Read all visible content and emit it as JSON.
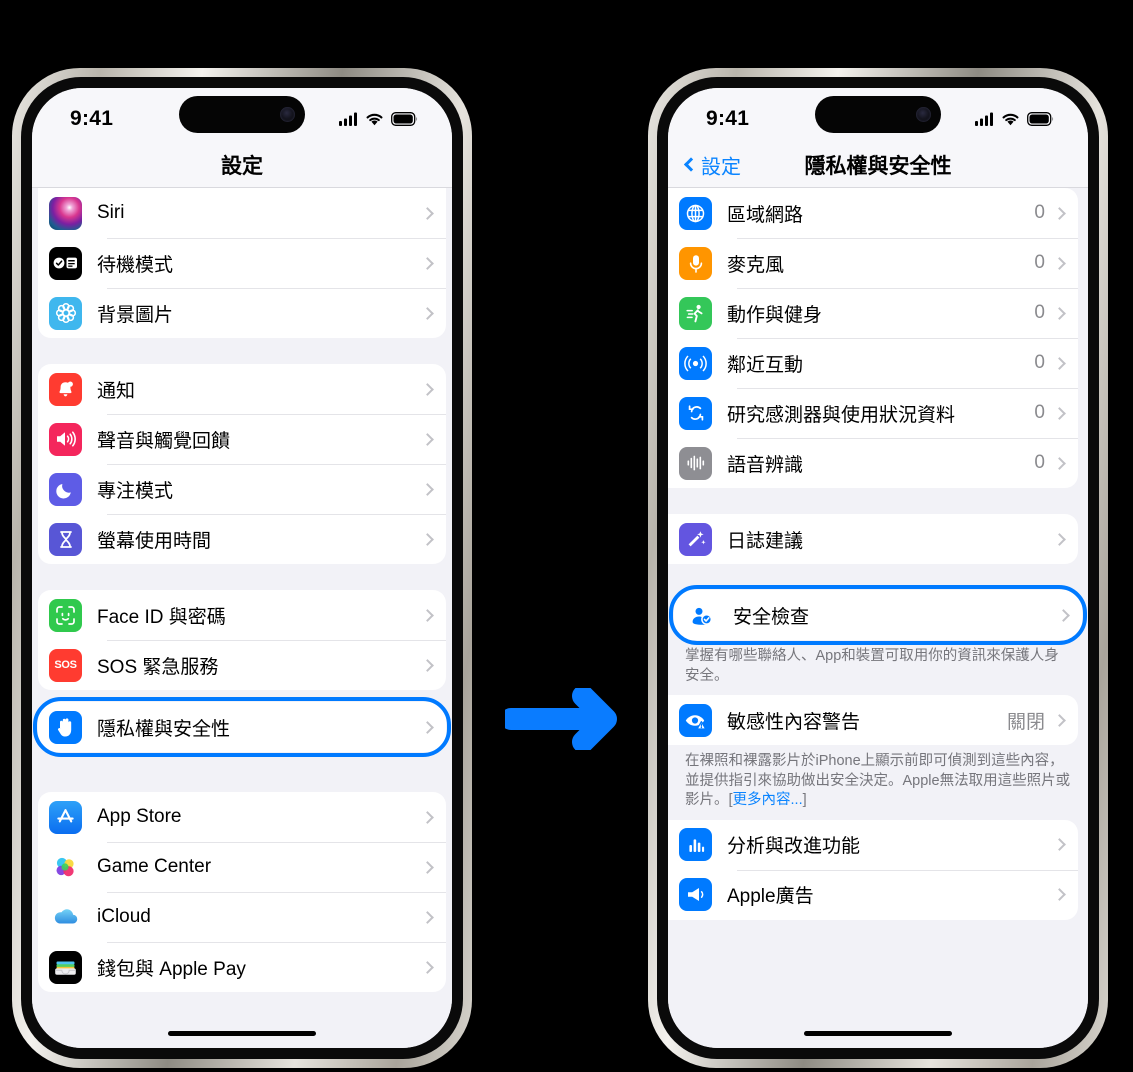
{
  "colors": {
    "accent_blue": "#007aff",
    "link_blue": "#0a84ff",
    "page_background": "#000000",
    "screen_background": "#f2f2f7"
  },
  "arrow": {
    "name": "right-arrow",
    "color": "#0a7cff"
  },
  "left_phone": {
    "status": {
      "time": "9:41",
      "cellular": "cellular-bars-icon",
      "wifi": "wifi-icon",
      "battery": "battery-full-icon"
    },
    "nav": {
      "title": "設定"
    },
    "groups": [
      {
        "rows": [
          {
            "icon": "siri-icon",
            "label": "Siri",
            "value": "",
            "chevron": true
          },
          {
            "icon": "standby-icon",
            "label": "待機模式",
            "value": "",
            "chevron": true
          },
          {
            "icon": "wallpaper-icon",
            "label": "背景圖片",
            "value": "",
            "chevron": true
          }
        ]
      },
      {
        "rows": [
          {
            "icon": "notifications-bell-icon",
            "label": "通知",
            "value": "",
            "chevron": true
          },
          {
            "icon": "sound-speaker-icon",
            "label": "聲音與觸覺回饋",
            "value": "",
            "chevron": true
          },
          {
            "icon": "focus-moon-icon",
            "label": "專注模式",
            "value": "",
            "chevron": true
          },
          {
            "icon": "screen-time-hourglass-icon",
            "label": "螢幕使用時間",
            "value": "",
            "chevron": true
          }
        ]
      },
      {
        "rows": [
          {
            "icon": "face-id-icon",
            "label": "Face ID 與密碼",
            "value": "",
            "chevron": true
          },
          {
            "icon": "sos-icon",
            "label": "SOS 緊急服務",
            "value": "",
            "chevron": true
          }
        ]
      },
      {
        "highlighted": true,
        "rows": [
          {
            "icon": "privacy-hand-icon",
            "label": "隱私權與安全性",
            "value": "",
            "chevron": true
          }
        ]
      },
      {
        "rows": [
          {
            "icon": "app-store-icon",
            "label": "App Store",
            "value": "",
            "chevron": true
          },
          {
            "icon": "game-center-icon",
            "label": "Game Center",
            "value": "",
            "chevron": true
          },
          {
            "icon": "icloud-icon",
            "label": "iCloud",
            "value": "",
            "chevron": true
          },
          {
            "icon": "wallet-icon",
            "label": "錢包與 Apple Pay",
            "value": "",
            "chevron": true
          }
        ]
      }
    ]
  },
  "right_phone": {
    "status": {
      "time": "9:41",
      "cellular": "cellular-bars-icon",
      "wifi": "wifi-icon",
      "battery": "battery-full-icon"
    },
    "nav": {
      "back_label": "設定",
      "title": "隱私權與安全性"
    },
    "groups": [
      {
        "rows": [
          {
            "icon": "local-network-globe-icon",
            "label": "區域網路",
            "value": "0",
            "chevron": true
          },
          {
            "icon": "microphone-icon",
            "label": "麥克風",
            "value": "0",
            "chevron": true
          },
          {
            "icon": "motion-fitness-icon",
            "label": "動作與健身",
            "value": "0",
            "chevron": true
          },
          {
            "icon": "nearby-interactions-icon",
            "label": "鄰近互動",
            "value": "0",
            "chevron": true
          },
          {
            "icon": "research-sensor-icon",
            "label": "研究感測器與使用狀況資料",
            "value": "0",
            "chevron": true
          },
          {
            "icon": "speech-recognition-icon",
            "label": "語音辨識",
            "value": "0",
            "chevron": true
          }
        ]
      },
      {
        "rows": [
          {
            "icon": "journaling-suggestions-icon",
            "label": "日誌建議",
            "value": "",
            "chevron": true
          }
        ]
      },
      {
        "highlighted": true,
        "rows": [
          {
            "icon": "safety-check-person-icon",
            "label": "安全檢查",
            "value": "",
            "chevron": true
          }
        ],
        "footnote": "掌握有哪些聯絡人、App和裝置可取用你的資訊來保護人身安全。"
      },
      {
        "rows": [
          {
            "icon": "sensitive-content-eye-icon",
            "label": "敏感性內容警告",
            "value": "關閉",
            "chevron": true
          }
        ],
        "footnote_main": "在裸照和裸露影片於iPhone上顯示前即可偵測到這些內容，並提供指引來協助做出安全決定。Apple無法取用這些照片或影片。[",
        "footnote_link": "更多內容...",
        "footnote_tail": "]"
      },
      {
        "rows": [
          {
            "icon": "analytics-chart-icon",
            "label": "分析與改進功能",
            "value": "",
            "chevron": true
          },
          {
            "icon": "apple-advertising-icon",
            "label": "Apple廣告",
            "value": "",
            "chevron": true
          }
        ]
      }
    ]
  }
}
